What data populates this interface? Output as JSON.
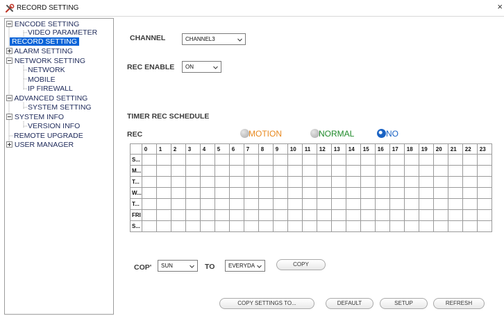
{
  "window": {
    "title": "RECORD SETTING",
    "close_glyph": "×",
    "icon": "tools-icon"
  },
  "sidebar": {
    "items": [
      {
        "label": "ENCODE SETTING",
        "level": 0,
        "expander": "minus"
      },
      {
        "label": "VIDEO PARAMETER",
        "level": 1
      },
      {
        "label": "RECORD SETTING",
        "level": 1,
        "selected": true
      },
      {
        "label": "ALARM SETTING",
        "level": 0,
        "expander": "plus"
      },
      {
        "label": "NETWORK SETTING",
        "level": 0,
        "expander": "minus"
      },
      {
        "label": "NETWORK",
        "level": 1
      },
      {
        "label": "MOBILE",
        "level": 1
      },
      {
        "label": "IP FIREWALL",
        "level": 1
      },
      {
        "label": "ADVANCED SETTING",
        "level": 0,
        "expander": "minus"
      },
      {
        "label": "SYSTEM SETTING",
        "level": 1
      },
      {
        "label": "SYSTEM INFO",
        "level": 0,
        "expander": "minus"
      },
      {
        "label": "VERSION INFO",
        "level": 1
      },
      {
        "label": "REMOTE UPGRADE",
        "level": 0
      },
      {
        "label": "USER MANAGER",
        "level": 0,
        "expander": "plus"
      }
    ]
  },
  "channel": {
    "label": "CHANNEL",
    "value": "CHANNEL3"
  },
  "rec_enable": {
    "label": "REC ENABLE",
    "value": "ON"
  },
  "schedule": {
    "title": "TIMER REC SCHEDULE",
    "rec_label": "REC",
    "modes": [
      {
        "label": "MOTION",
        "color": "#e8891f",
        "selected": false
      },
      {
        "label": "NORMAL",
        "color": "#1f8a2a",
        "selected": false
      },
      {
        "label": "NO",
        "color": "#1a63c4",
        "selected": true
      }
    ],
    "hours": [
      "0",
      "1",
      "2",
      "3",
      "4",
      "5",
      "6",
      "7",
      "8",
      "9",
      "10",
      "11",
      "12",
      "13",
      "14",
      "15",
      "16",
      "17",
      "18",
      "19",
      "20",
      "21",
      "22",
      "23"
    ],
    "days": [
      "S...",
      "M...",
      "T...",
      "W...",
      "T...",
      "FRI",
      "S..."
    ]
  },
  "copy_row": {
    "copy_label": "COP'",
    "from_value": "SUN",
    "to_label": "TO",
    "to_value": "EVERYDA",
    "copy_button": "COPY"
  },
  "footer": {
    "copy_settings_button": "COPY SETTINGS TO...",
    "default_button": "DEFAULT",
    "setup_button": "SETUP",
    "refresh_button": "REFRESH"
  },
  "colors": {
    "selection": "#0a64d8",
    "tree_text": "#1e2a5a",
    "radio_off": "#b0b0b0"
  }
}
